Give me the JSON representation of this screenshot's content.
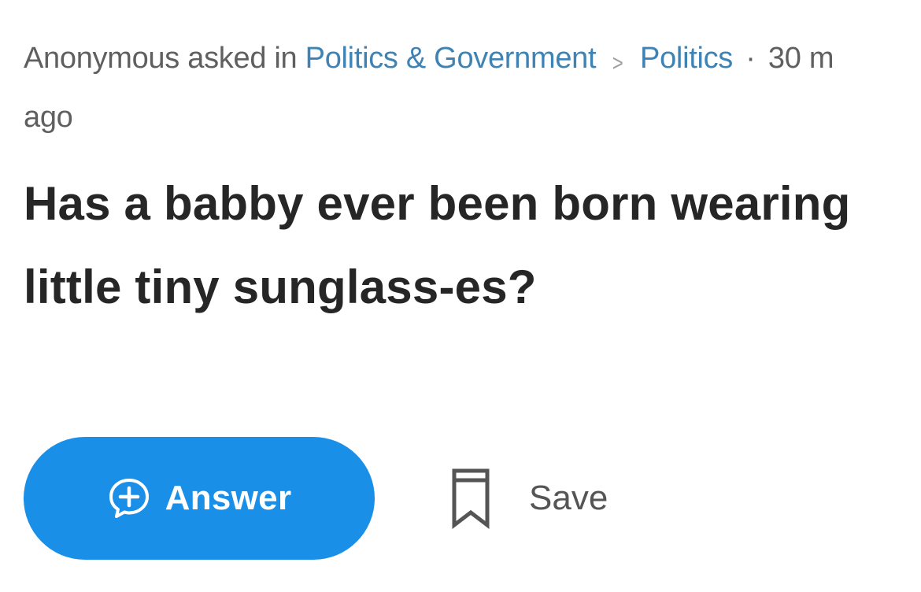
{
  "question": {
    "author": "Anonymous",
    "asked_in": "asked in",
    "category": "Politics & Government",
    "subcategory": "Politics",
    "separator": "·",
    "time_ago": "30 m",
    "time_ago_cont": "ago",
    "title": "Has a babby ever been born wearing little tiny sunglass-es?"
  },
  "actions": {
    "answer_label": "Answer",
    "answer_icon": "add-comment-icon",
    "save_label": "Save",
    "save_icon": "bookmark-icon",
    "answer_color": "#1a8fe8"
  }
}
